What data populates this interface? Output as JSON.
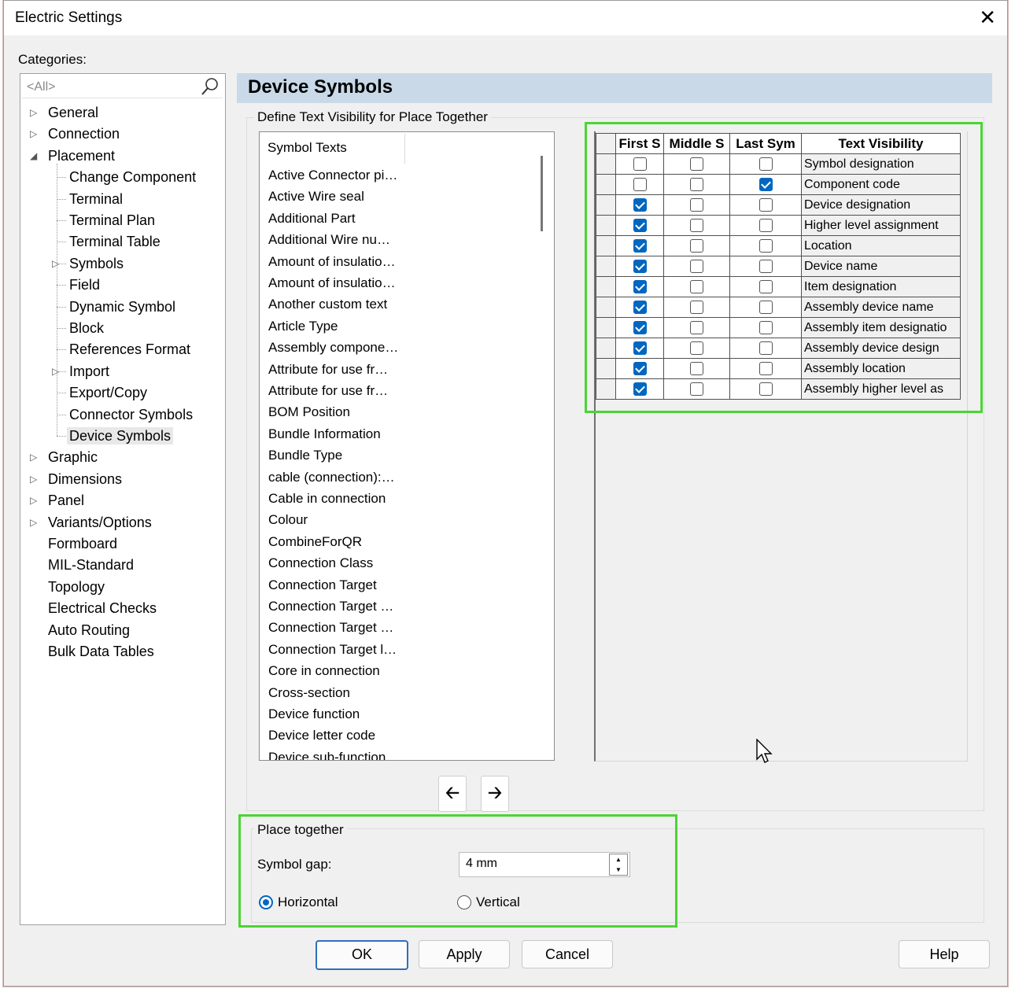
{
  "window": {
    "title": "Electric Settings",
    "close_glyph": "✕"
  },
  "categories": {
    "label": "Categories:",
    "search_placeholder": "<All>",
    "items": [
      {
        "label": "General",
        "expander": "▷"
      },
      {
        "label": "Connection",
        "expander": "▷"
      },
      {
        "label": "Placement",
        "expander": "◢"
      },
      {
        "label": "Change Component"
      },
      {
        "label": "Terminal"
      },
      {
        "label": "Terminal Plan"
      },
      {
        "label": "Terminal Table"
      },
      {
        "label": "Symbols",
        "expander": "▷"
      },
      {
        "label": "Field"
      },
      {
        "label": "Dynamic Symbol"
      },
      {
        "label": "Block"
      },
      {
        "label": "References Format"
      },
      {
        "label": "Import",
        "expander": "▷"
      },
      {
        "label": "Export/Copy"
      },
      {
        "label": "Connector Symbols"
      },
      {
        "label": "Device Symbols",
        "selected": true
      },
      {
        "label": "Graphic",
        "expander": "▷"
      },
      {
        "label": "Dimensions",
        "expander": "▷"
      },
      {
        "label": "Panel",
        "expander": "▷"
      },
      {
        "label": "Variants/Options",
        "expander": "▷"
      },
      {
        "label": "Formboard"
      },
      {
        "label": "MIL-Standard"
      },
      {
        "label": "Topology"
      },
      {
        "label": "Electrical Checks"
      },
      {
        "label": "Auto Routing"
      },
      {
        "label": "Bulk Data Tables"
      }
    ]
  },
  "page": {
    "title": "Device Symbols",
    "visibility_group_label": "Define Text Visibility for Place Together",
    "symbol_texts": {
      "header": "Symbol Texts",
      "items": [
        "Active Connector pi…",
        "Active Wire seal",
        "Additional Part",
        "Additional Wire nu…",
        "Amount of insulatio…",
        "Amount of insulatio…",
        "Another custom text",
        "Article Type",
        "Assembly compone…",
        "Attribute for use fr…",
        "Attribute for use fr…",
        "BOM Position",
        "Bundle Information",
        "Bundle Type",
        "cable (connection):…",
        "Cable in connection",
        "Colour",
        "CombineForQR",
        "Connection Class",
        "Connection Target",
        "Connection Target …",
        "Connection Target …",
        "Connection Target l…",
        "Core in connection",
        "Cross-section",
        "Device function",
        "Device letter code",
        "Device sub-function"
      ]
    },
    "arrows": {
      "left": "🡠",
      "right": "🡢"
    },
    "grid": {
      "columns": [
        "First S",
        "Middle S",
        "Last Sym",
        "Text Visibility"
      ],
      "rows": [
        {
          "first": false,
          "middle": false,
          "last": false,
          "text": "Symbol designation"
        },
        {
          "first": false,
          "middle": false,
          "last": true,
          "text": "Component code"
        },
        {
          "first": true,
          "middle": false,
          "last": false,
          "text": "Device designation"
        },
        {
          "first": true,
          "middle": false,
          "last": false,
          "text": "Higher level assignment"
        },
        {
          "first": true,
          "middle": false,
          "last": false,
          "text": "Location"
        },
        {
          "first": true,
          "middle": false,
          "last": false,
          "text": "Device name"
        },
        {
          "first": true,
          "middle": false,
          "last": false,
          "text": "Item designation"
        },
        {
          "first": true,
          "middle": false,
          "last": false,
          "text": "Assembly device name"
        },
        {
          "first": true,
          "middle": false,
          "last": false,
          "text": "Assembly item designatio"
        },
        {
          "first": true,
          "middle": false,
          "last": false,
          "text": "Assembly device design"
        },
        {
          "first": true,
          "middle": false,
          "last": false,
          "text": "Assembly location"
        },
        {
          "first": true,
          "middle": false,
          "last": false,
          "text": "Assembly higher level as"
        }
      ]
    },
    "place_together": {
      "label": "Place together",
      "gap_label": "Symbol gap:",
      "gap_value": "4 mm",
      "orientation": [
        {
          "label": "Horizontal",
          "checked": true
        },
        {
          "label": "Vertical",
          "checked": false
        }
      ]
    }
  },
  "buttons": {
    "ok": "OK",
    "apply": "Apply",
    "cancel": "Cancel",
    "help": "Help"
  },
  "colors": {
    "accent": "#0067c0",
    "highlight": "#4cd434",
    "header_bg": "#c9d9e8"
  }
}
